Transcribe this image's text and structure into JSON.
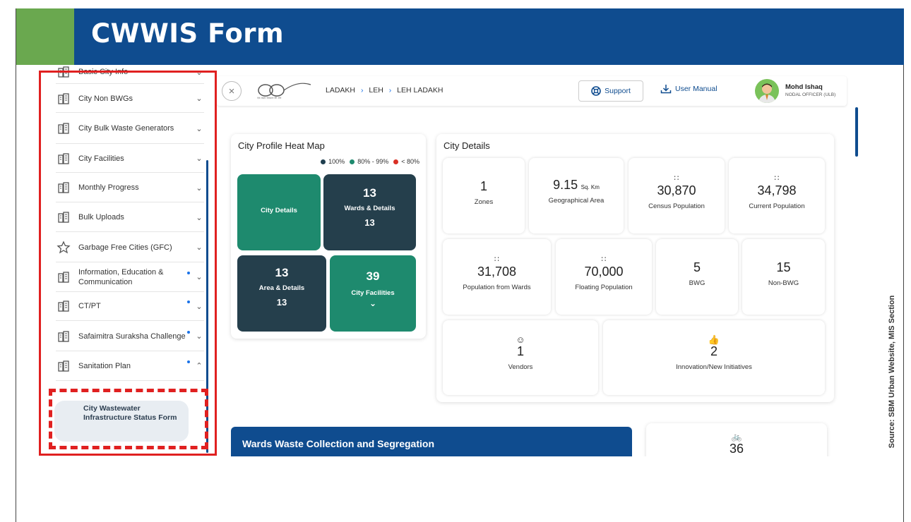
{
  "slide": {
    "title": "CWWIS Form",
    "source": "Source: SBM Urban Website, MIS Section"
  },
  "sidebar": {
    "items": [
      {
        "label": "Basic City Info",
        "icon": "city-info-icon",
        "chevron": "⌄",
        "dot": false
      },
      {
        "label": "City Non BWGs",
        "icon": "buildings-icon",
        "chevron": "⌄",
        "dot": false
      },
      {
        "label": "City Bulk Waste Generators",
        "icon": "waste-generator-icon",
        "chevron": "⌄",
        "dot": false
      },
      {
        "label": "City Facilities",
        "icon": "facilities-icon",
        "chevron": "⌄",
        "dot": false
      },
      {
        "label": "Monthly Progress",
        "icon": "progress-icon",
        "chevron": "⌄",
        "dot": false
      },
      {
        "label": "Bulk Uploads",
        "icon": "upload-icon",
        "chevron": "⌄",
        "dot": false
      },
      {
        "label": "Garbage Free Cities (GFC)",
        "icon": "star-icon",
        "chevron": "⌄",
        "dot": false
      },
      {
        "label": "Information, Education & Communication",
        "icon": "iec-icon",
        "chevron": "⌄",
        "dot": true
      },
      {
        "label": "CT/PT",
        "icon": "toilet-icon",
        "chevron": "⌄",
        "dot": true
      },
      {
        "label": "Safaimitra Suraksha Challenge",
        "icon": "safaimitra-icon",
        "chevron": "⌄",
        "dot": true
      },
      {
        "label": "Sanitation Plan",
        "icon": "sanitation-icon",
        "chevron": "⌃",
        "dot": true
      }
    ],
    "submenu": {
      "label": "City Wastewater Infrastructure Status Form"
    }
  },
  "topbar": {
    "breadcrumb": [
      "LADAKH",
      "LEH",
      "LEH LADAKH"
    ],
    "breadcrumb_sep": "›",
    "close_glyph": "×",
    "support_label": "Support",
    "manual_label": "User Manual",
    "user_name": "Mohd Ishaq",
    "user_role": "NODAL OFFICER (ULB)",
    "logo_caption": "एक कदम स्वच्छता की ओर"
  },
  "heatmap": {
    "title": "City Profile Heat Map",
    "legend": [
      {
        "label": "100%",
        "color": "#1f3f4f"
      },
      {
        "label": "80% - 99%",
        "color": "#1e8a6e"
      },
      {
        "label": "< 80%",
        "color": "#d93025"
      }
    ],
    "tiles": {
      "city_details": {
        "label": "City Details"
      },
      "wards": {
        "number": "13",
        "label": "Wards & Details",
        "sub": "13"
      },
      "area": {
        "number": "13",
        "label": "Area & Details",
        "sub": "13"
      },
      "facilities": {
        "number": "39",
        "label": "City Facilities",
        "chevron": "⌄"
      }
    }
  },
  "city_details": {
    "title": "City Details",
    "stats": {
      "zones": {
        "value": "1",
        "label": "Zones"
      },
      "geo_area": {
        "value": "9.15",
        "unit": "Sq. Km",
        "label": "Geographical Area"
      },
      "census_pop": {
        "value": "30,870",
        "label": "Census Population"
      },
      "current_pop": {
        "value": "34,798",
        "label": "Current Population"
      },
      "pop_wards": {
        "value": "31,708",
        "label": "Population from Wards"
      },
      "floating_pop": {
        "value": "70,000",
        "label": "Floating Population"
      },
      "bwg": {
        "value": "5",
        "label": "BWG"
      },
      "non_bwg": {
        "value": "15",
        "label": "Non-BWG"
      },
      "vendors": {
        "value": "1",
        "label": "Vendors"
      },
      "innovation": {
        "value": "2",
        "label": "Innovation/New Initiatives"
      }
    }
  },
  "wards_section": {
    "title": "Wards Waste Collection and Segregation"
  },
  "partial_card": {
    "value": "36"
  },
  "colors": {
    "primary": "#0f4c8f",
    "accent_green": "#6aa84f",
    "tile_dark": "#253f4c",
    "tile_green": "#1e8a6e",
    "highlight_red": "#e02020"
  }
}
